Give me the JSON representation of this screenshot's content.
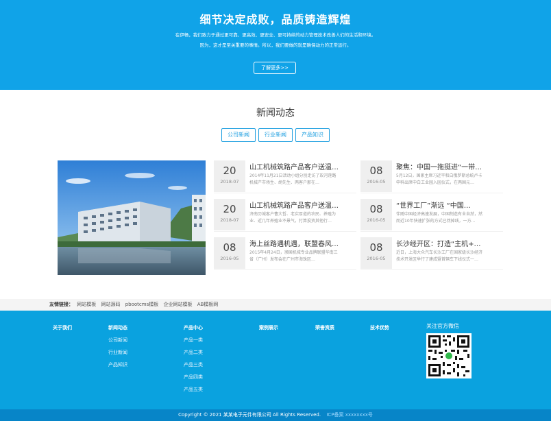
{
  "hero": {
    "title": "细节决定成败，品质铸造辉煌",
    "desc_line1": "在伊畅，我们致力于通过更可靠、更高效、更安全、更可持续的动力管理技术改善人们的生活和环境。",
    "desc_line2": "因为，这才是至关重要的事情。所以，我们要做的就是确保动力的正常运行。",
    "button_label": "了解更多>>"
  },
  "news": {
    "title": "新闻动态",
    "tabs": [
      "公司新闻",
      "行业新闻",
      "产品知识"
    ],
    "items": [
      {
        "day": "20",
        "ym": "2018-07",
        "title": "山工机械筑路产品客户送温…",
        "summary": "2014年11月21日活动小组分别走访了玫河莲路机械产市场生、胡先生、两客户那在…"
      },
      {
        "day": "08",
        "ym": "2016-05",
        "title": "聚焦：中国一拖挺进“一带…",
        "summary": "5月12日，国家主席习近平和白俄罗斯总统卢卡申科出席中白工业园入园仪式，在两国元…"
      },
      {
        "day": "20",
        "ym": "2018-07",
        "title": "山工机械筑路产品客户送温…",
        "summary": "济南历城客户曹大哲、老实厚道的农民、养殖为业、近几年养殖业不景气，打算投资其他行…"
      },
      {
        "day": "08",
        "ym": "2016-05",
        "title": "“世界工厂”渐远 “中国…",
        "summary": "伴随中国经济高速发展，中国制造有业自然，然而近10年快速扩张的方式已然掉线，一方…"
      },
      {
        "day": "08",
        "ym": "2016-05",
        "title": "海上丝路遇机遇，联盟春风…",
        "summary": "2015年4月24日，濒国机械专业品牌联盟华南三省（广州）发布会在广州市海珠区…"
      },
      {
        "day": "08",
        "ym": "2016-05",
        "title": "长沙经开区：打造“主机+…",
        "summary": "近日，上海大众汽车长沙工厂在国家级长沙经济技术开发区举行了建成暨首辆车下线仪式一…"
      }
    ]
  },
  "links": {
    "label": "友情链接：",
    "items": [
      "网站模板",
      "网站源码",
      "pbootcms模板",
      "企业网站模板",
      "AB模板网"
    ]
  },
  "footer": {
    "cols": [
      {
        "head": "关于我们",
        "subs": []
      },
      {
        "head": "新闻动态",
        "subs": [
          "公司新闻",
          "行业新闻",
          "产品知识"
        ]
      },
      {
        "head": "产品中心",
        "subs": [
          "产品一类",
          "产品二类",
          "产品三类",
          "产品四类",
          "产品五类"
        ]
      },
      {
        "head": "案例展示",
        "subs": []
      },
      {
        "head": "荣誉资质",
        "subs": []
      },
      {
        "head": "技术优势",
        "subs": []
      }
    ],
    "qr_title": "关注官方微信",
    "copyright": "Copyright © 2021 某某电子元件有限公司 All Rights Reserved.",
    "copyright_extra": "ICP备案  xxxxxxxx号"
  },
  "colors": {
    "primary": "#10a3e8",
    "footer": "#0aa2df",
    "copyright_bg": "#0785c8"
  }
}
